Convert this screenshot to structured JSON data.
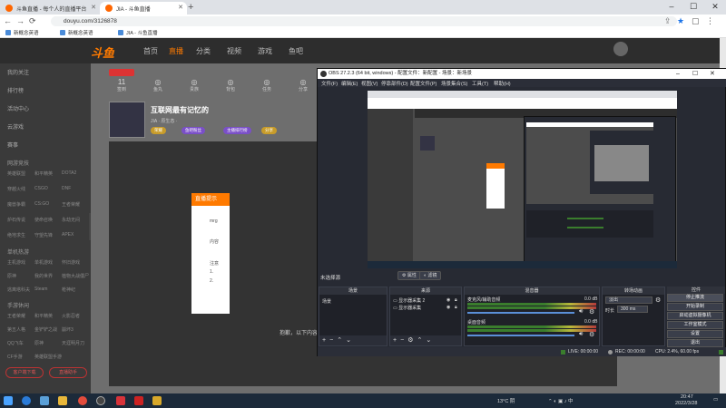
{
  "browser": {
    "tabs": [
      {
        "label": "斗鱼直播 - 每个人的直播平台",
        "active": false
      },
      {
        "label": "JIA - 斗鱼直播",
        "active": true
      }
    ],
    "url": "douyu.com/3126878",
    "bookmarks": [
      "新概念英语",
      "新概念英语",
      "JIA - 斗鱼直播"
    ]
  },
  "douyu": {
    "logo": "斗鱼",
    "nav": [
      "首页",
      "直播",
      "分类",
      "视频",
      "游戏",
      "鱼吧"
    ],
    "sidebar": {
      "top_items": [
        "我的关注",
        "排行榜",
        "活动中心",
        "云游戏",
        "赛事"
      ],
      "section1_title": "网游竞技",
      "section1_items": [
        [
          "英雄联盟",
          "和平精英",
          "DOTA2"
        ],
        [
          "穿越火线",
          "CSGO",
          "DNF"
        ],
        [
          "魔兽争霸",
          "CS:GO",
          "王者荣耀"
        ],
        [
          "炉石传说",
          "使命召唤",
          "永劫无间"
        ],
        [
          "绝地求生",
          "守望先锋",
          "APEX"
        ]
      ],
      "section2_title": "单机热游",
      "section2_items": [
        [
          "主机游戏",
          "单机游戏",
          "怀旧游戏"
        ],
        [
          "原神",
          "我的世界",
          "植物大战僵尸"
        ],
        [
          "逃离塔科夫",
          "Steam",
          "枪神纪"
        ]
      ],
      "section3_title": "手游休闲",
      "section3_items": [
        [
          "王者荣耀",
          "和平精英",
          "火影忍者"
        ],
        [
          "第五人格",
          "金铲铲之战",
          "崩坏3"
        ],
        [
          "QQ飞车",
          "原神",
          "天涯明月刀"
        ],
        [
          "CF手游",
          "英雄联盟手游",
          ""
        ]
      ],
      "buttons": [
        "客户端下载",
        "直播助手"
      ]
    },
    "stats": [
      {
        "value": "11",
        "label": "签到"
      },
      {
        "value": "",
        "label": "鱼丸"
      },
      {
        "value": "",
        "label": "贵族"
      },
      {
        "value": "",
        "label": "背包"
      },
      {
        "value": "",
        "label": "任务"
      },
      {
        "value": "",
        "label": "分享"
      }
    ],
    "room": {
      "title": "互联网最有记忆的",
      "meta": "JIA · 原生态 ·",
      "tags": [
        "荣耀",
        "鱼吧粉丝",
        "主播排行榜",
        "分享"
      ]
    },
    "popup": {
      "header": "直播提示",
      "lines": [
        "mrg",
        "内容",
        "注意",
        "1.",
        "2."
      ]
    },
    "footer_text": "抱歉，以下内容"
  },
  "obs": {
    "title": "OBS 27.2.3 (64 bit, windows) - 配置文件：新配置 - 场景：新场景",
    "menu": [
      "文件(F)",
      "编辑(E)",
      "视图(V)",
      "停靠部件(D)",
      "配置文件(P)",
      "场景集合(S)",
      "工具(T)",
      "帮助(H)"
    ],
    "scene_label": "未选择源",
    "scene_buttons": [
      "属性",
      "滤镜"
    ],
    "docks": {
      "scenes": {
        "title": "场景",
        "items": [
          "场景"
        ]
      },
      "sources": {
        "title": "来源",
        "items": [
          "显示器采集 2",
          "显示器采集"
        ]
      },
      "mixer": {
        "title": "混音器",
        "tracks": [
          {
            "name": "麦克风/辅助音频",
            "db": "0.0 dB"
          },
          {
            "name": "桌面音频",
            "db": "0.0 dB"
          }
        ]
      },
      "transitions": {
        "title": "转场动画",
        "type": "淡出",
        "duration_label": "时长",
        "duration": "300 ms"
      },
      "controls": {
        "title": "控件",
        "buttons": [
          "停止推流",
          "开始录制",
          "启动虚拟摄像机",
          "工作室模式",
          "设置",
          "退出"
        ]
      }
    },
    "status": {
      "live": "LIVE: 00:00:00",
      "rec": "REC: 00:00:00",
      "cpu": "CPU: 2.4%, 60.00 fps"
    }
  },
  "taskbar": {
    "weather": "13°C 阴",
    "time": "20:47",
    "date": "2022/3/28"
  }
}
